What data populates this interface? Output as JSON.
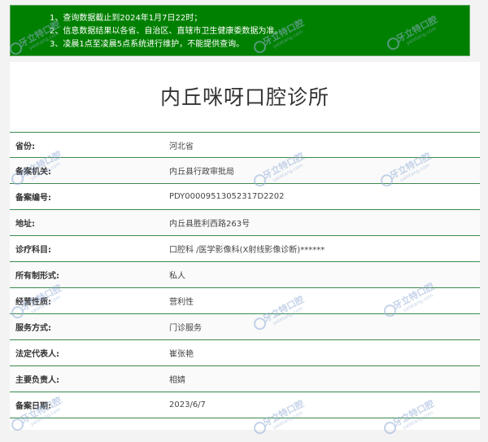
{
  "notice": {
    "lines": [
      "1、查询数据截止到2024年1月7日22时；",
      "2、信息数据结果以各省、自治区、直辖市卫生健康委数据为准。",
      "3、凌晨1点至凌晨5点系统进行维护，不能提供查询。"
    ]
  },
  "clinic": {
    "title": "内丘咪呀口腔诊所",
    "fields": [
      {
        "label": "省份:",
        "value": "河北省"
      },
      {
        "label": "备案机关:",
        "value": "内丘县行政审批局"
      },
      {
        "label": "备案编号:",
        "value": "PDY00009513052317D2202"
      },
      {
        "label": "地址:",
        "value": "内丘县胜利西路263号"
      },
      {
        "label": "诊疗科目:",
        "value": "口腔科 /医学影像科(X射线影像诊断)******"
      },
      {
        "label": "所有制形式:",
        "value": "私人"
      },
      {
        "label": "经营性质:",
        "value": "营利性"
      },
      {
        "label": "服务方式:",
        "value": "门诊服务"
      },
      {
        "label": "法定代表人:",
        "value": "崔张艳"
      },
      {
        "label": "主要负责人:",
        "value": "相婧"
      },
      {
        "label": "备案日期:",
        "value": "2023/6/7"
      }
    ]
  },
  "watermark": {
    "cn": "牙立特口腔",
    "en": "yaletang.com"
  }
}
